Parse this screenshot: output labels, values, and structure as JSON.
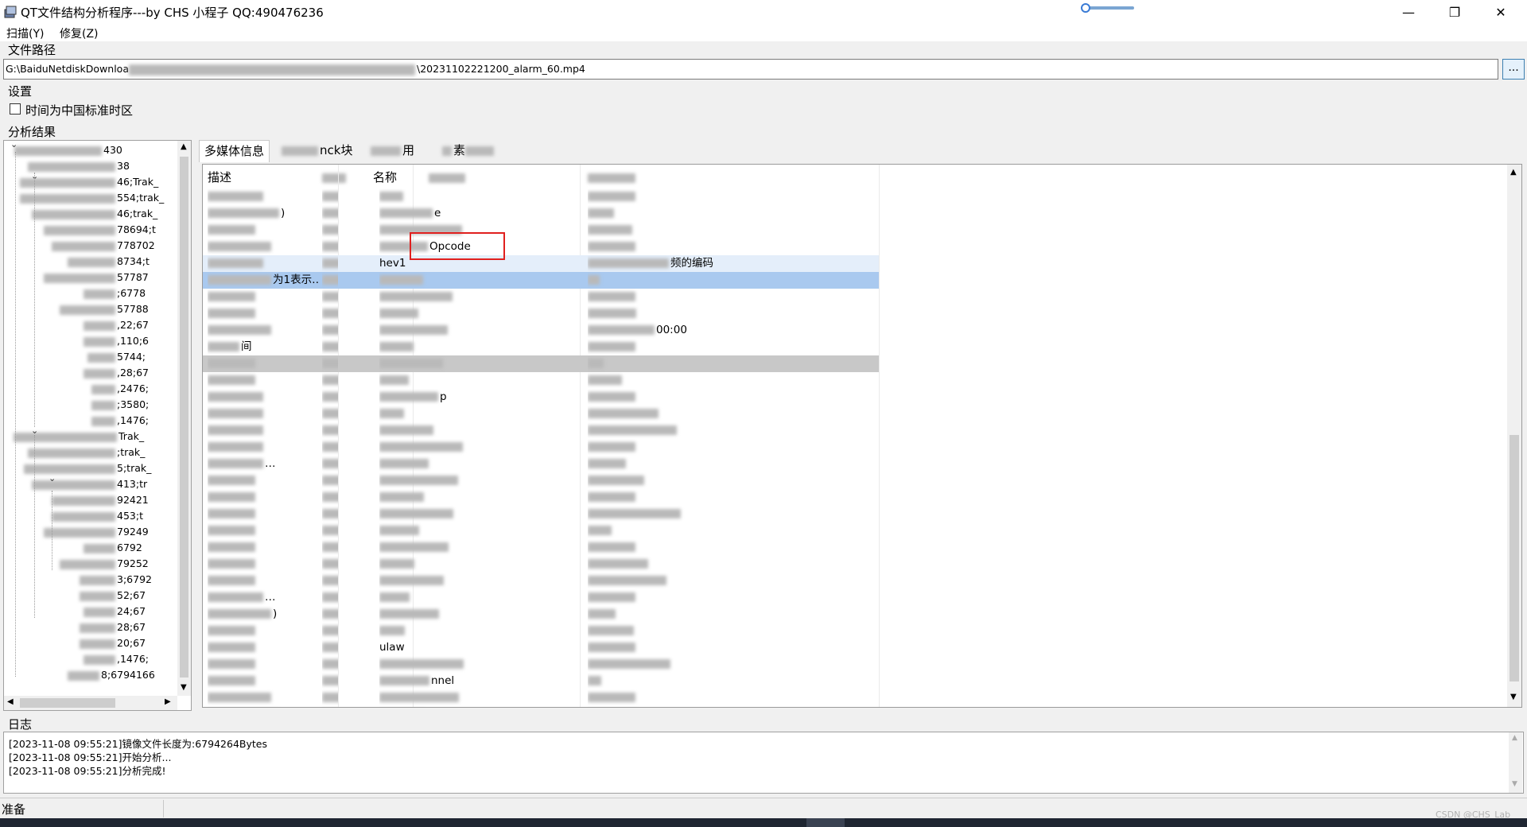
{
  "window": {
    "title": "QT文件结构分析程序---by CHS 小程子 QQ:490476236",
    "minimize": "—",
    "restore": "❐",
    "close": "✕"
  },
  "menu": [
    "扫描(Y)",
    "修复(Z)"
  ],
  "file_path": {
    "label": "文件路径",
    "value_start": "G:\\BaiduNetdiskDownloa",
    "value_end": "\\20231102221200_alarm_60.mp4",
    "browse": "..."
  },
  "settings": {
    "label": "设置",
    "checkbox_label": "时间为中国标准时区",
    "checked": false
  },
  "analysis": {
    "label": "分析结果"
  },
  "tree_nodes": [
    "430",
    "38",
    "46;Trak_",
    "554;trak_",
    "46;trak_",
    "78694;t",
    "778702",
    "8734;t",
    "57787",
    ";6778",
    "57788",
    ",22;67",
    ",110;6",
    "5744;",
    ",28;67",
    ",2476;",
    ";3580;",
    ",1476;",
    "Trak_",
    ";trak_",
    "5;trak_",
    "413;tr",
    "92421",
    "453;t",
    "79249",
    "6792",
    "79252",
    "3;6792",
    "52;67",
    "24;67",
    "28;67",
    "20;67",
    ",1476;",
    "8;6794166"
  ],
  "tabs": [
    "多媒体信息",
    "nck块",
    "用",
    "素"
  ],
  "table": {
    "headers": [
      "描述",
      "名称",
      "",
      ""
    ],
    "rows": [
      [
        "",
        "",
        "",
        ""
      ],
      [
        ")",
        "",
        "e",
        ""
      ],
      [
        "",
        "",
        "",
        ""
      ],
      [
        "",
        "",
        "Opcode",
        ""
      ],
      [
        "",
        "",
        "hev1",
        "频的编码"
      ],
      [
        "为1表示…",
        "",
        "",
        ""
      ],
      [
        "",
        "",
        "",
        ""
      ],
      [
        "",
        "",
        "",
        ""
      ],
      [
        "",
        "",
        "",
        "00:00"
      ],
      [
        "间",
        "",
        "",
        ""
      ],
      [
        "",
        "",
        "",
        ""
      ],
      [
        "",
        "",
        "",
        ""
      ],
      [
        "",
        "",
        "p",
        ""
      ],
      [
        "",
        "",
        "",
        ""
      ],
      [
        "",
        "",
        "",
        ""
      ],
      [
        "",
        "",
        "",
        ""
      ],
      [
        "…",
        "",
        "",
        ""
      ],
      [
        "",
        "",
        "",
        ""
      ],
      [
        "",
        "",
        "",
        ""
      ],
      [
        "",
        "",
        "",
        ""
      ],
      [
        "",
        "",
        "",
        ""
      ],
      [
        "",
        "",
        "",
        ""
      ],
      [
        "",
        "",
        "",
        ""
      ],
      [
        "",
        "",
        "",
        ""
      ],
      [
        "…",
        "",
        "",
        ""
      ],
      [
        ")",
        "",
        "",
        ""
      ],
      [
        "",
        "",
        "",
        ""
      ],
      [
        "",
        "",
        "ulaw",
        ""
      ],
      [
        "",
        "",
        "",
        ""
      ],
      [
        "",
        "",
        "nnel",
        ""
      ],
      [
        "",
        "",
        "",
        ""
      ],
      [
        "",
        "",
        "",
        ""
      ]
    ]
  },
  "log": {
    "label": "日志",
    "lines": [
      "[2023-11-08 09:55:21]镜像文件长度为:6794264Bytes",
      "[2023-11-08 09:55:21]开始分析...",
      "[2023-11-08 09:55:21]分析完成!"
    ]
  },
  "status": "准备",
  "watermark": "CSDN @CHS_Lab",
  "colors": {
    "selected_row": "#a9c9ef",
    "highlight_row": "#e4eefa",
    "gray_row": "#c8c8c8",
    "annotation_box": "#e0201e"
  }
}
